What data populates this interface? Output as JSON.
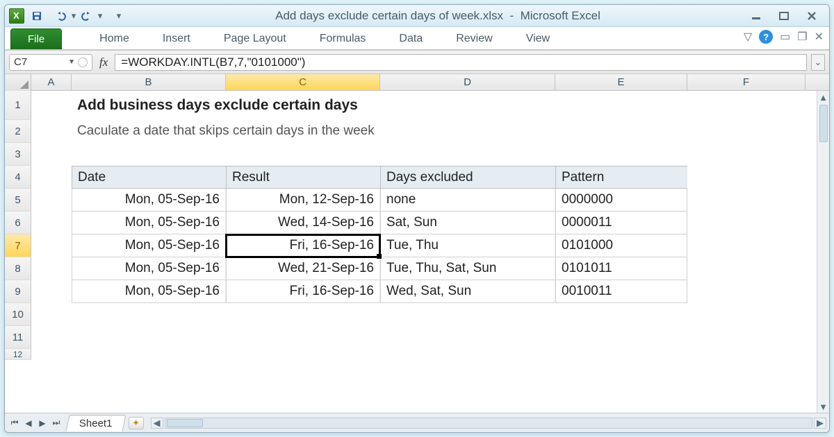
{
  "window": {
    "title_doc": "Add days exclude certain days of week.xlsx",
    "title_app": "Microsoft Excel"
  },
  "ribbon": {
    "file": "File",
    "tabs": [
      "Home",
      "Insert",
      "Page Layout",
      "Formulas",
      "Data",
      "Review",
      "View"
    ]
  },
  "namebox": "C7",
  "fx": "fx",
  "formula": "=WORKDAY.INTL(B7,7,\"0101000\")",
  "columns": [
    "A",
    "B",
    "C",
    "D",
    "E",
    "F"
  ],
  "active_col": "C",
  "active_row": "7",
  "rows_visible": [
    "1",
    "2",
    "3",
    "4",
    "5",
    "6",
    "7",
    "8",
    "9",
    "10",
    "11",
    "12"
  ],
  "content": {
    "title": "Add business days exclude certain days",
    "subtitle": "Caculate a date that skips certain days in the week",
    "headers": {
      "date": "Date",
      "result": "Result",
      "excluded": "Days excluded",
      "pattern": "Pattern"
    },
    "data": [
      {
        "date": "Mon, 05-Sep-16",
        "result": "Mon, 12-Sep-16",
        "excluded": "none",
        "pattern": "0000000"
      },
      {
        "date": "Mon, 05-Sep-16",
        "result": "Wed, 14-Sep-16",
        "excluded": "Sat, Sun",
        "pattern": "0000011"
      },
      {
        "date": "Mon, 05-Sep-16",
        "result": "Fri, 16-Sep-16",
        "excluded": "Tue, Thu",
        "pattern": "0101000"
      },
      {
        "date": "Mon, 05-Sep-16",
        "result": "Wed, 21-Sep-16",
        "excluded": "Tue, Thu, Sat, Sun",
        "pattern": "0101011"
      },
      {
        "date": "Mon, 05-Sep-16",
        "result": "Fri, 16-Sep-16",
        "excluded": "Wed, Sat, Sun",
        "pattern": "0010011"
      }
    ]
  },
  "sheet_tab": "Sheet1"
}
